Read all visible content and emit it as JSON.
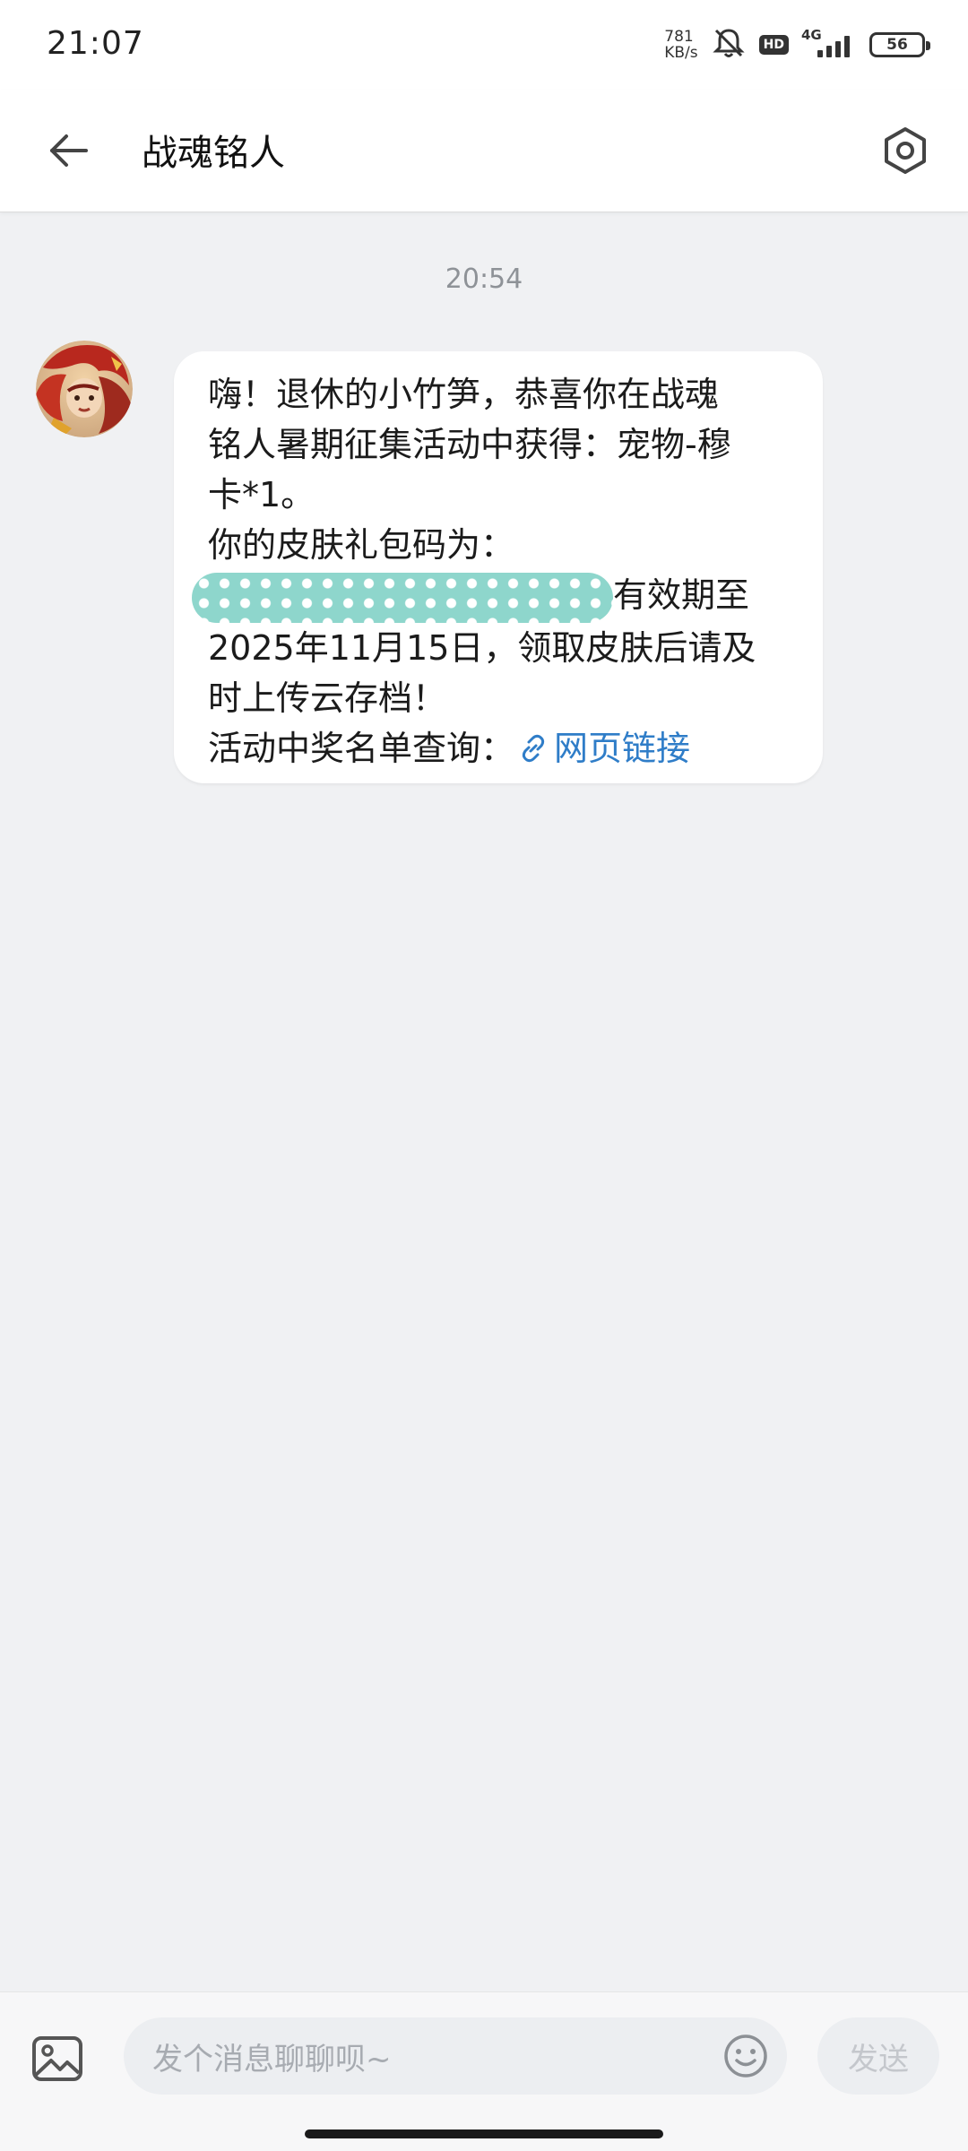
{
  "status_bar": {
    "time": "21:07",
    "net_speed_value": "781",
    "net_speed_unit": "KB/s",
    "hd_label": "HD",
    "network_type": "4G",
    "battery_level": "56",
    "icons": [
      "mute-bell-icon",
      "hd-icon",
      "signal-icon",
      "battery-icon"
    ]
  },
  "header": {
    "back_icon": "arrow-left-icon",
    "title": "战魂铭人",
    "settings_icon": "hexagon-settings-icon"
  },
  "chat": {
    "timestamp": "20:54",
    "message": {
      "lines": [
        "嗨！退休的小竹笋，恭喜你在战魂",
        "铭人暑期征集活动中获得：宠物-穆",
        "卡*1。",
        "你的皮肤礼包码为：",
        "有效期至",
        "2025年11月15日，领取皮肤后请及",
        "时上传云存档！",
        "活动中奖名单查询："
      ],
      "link_text": "网页链接",
      "link_icon": "link-icon"
    }
  },
  "input_bar": {
    "image_icon": "image-icon",
    "placeholder": "发个消息聊聊呗~",
    "emoji_icon": "emoji-icon",
    "send_label": "发送"
  },
  "colors": {
    "background": "#f0f1f3",
    "bubble": "#ffffff",
    "link": "#2f7dc8",
    "redaction": "#8ed6cc"
  }
}
